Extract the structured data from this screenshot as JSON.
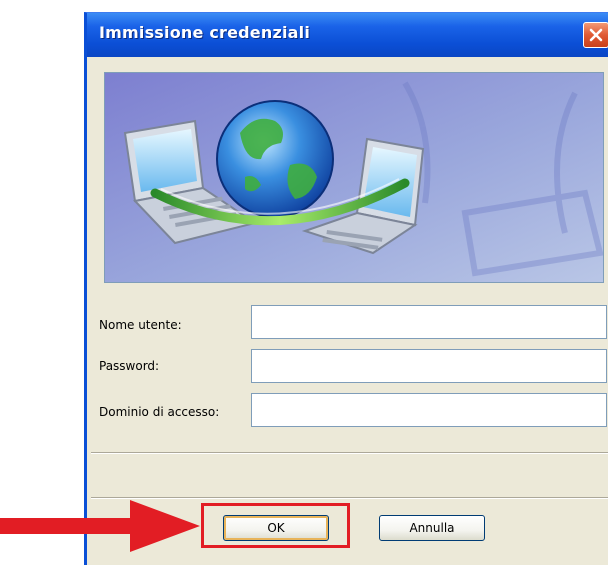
{
  "dialog": {
    "title": "Immissione credenziali"
  },
  "form": {
    "username_label": "Nome utente:",
    "username_value": "",
    "password_label": "Password:",
    "password_value": "",
    "domain_label": "Dominio di accesso:",
    "domain_value": ""
  },
  "buttons": {
    "ok_label": "OK",
    "cancel_label": "Annulla"
  },
  "annotation": {
    "color": "#e21d24"
  },
  "colors": {
    "titlebar": "#0b4fd6",
    "dialog_bg": "#ece9d8",
    "close_button": "#e05a34"
  },
  "icons": {
    "close": "close-icon",
    "banner": "network-globe-laptops-illustration"
  }
}
